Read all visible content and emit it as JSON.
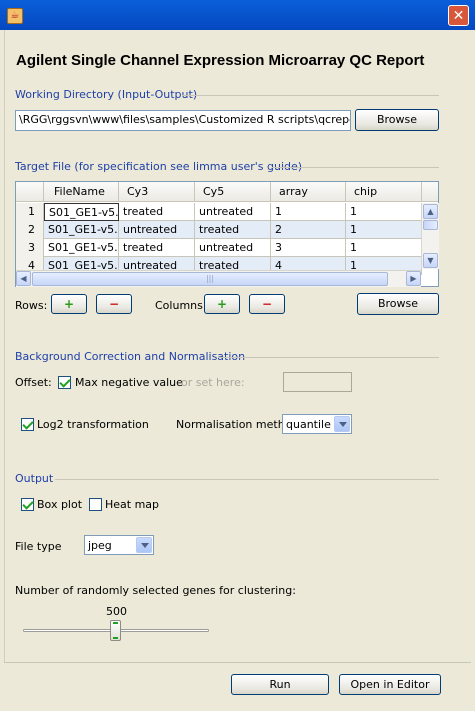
{
  "window": {
    "close_symbol": "✕",
    "icon": "java-cup-icon"
  },
  "report_title": "Agilent Single Channel Expression Microarray QC Report",
  "working_directory": {
    "label": "Working Directory (Input-Output)",
    "path": "\\RGG\\rggsvn\\www\\files\\samples\\Customized R scripts\\qcreport\\data",
    "browse_label": "Browse"
  },
  "target_file": {
    "label": "Target File   (for specification see limma user's guide)",
    "columns": [
      "",
      "FileName",
      "Cy3",
      "Cy5",
      "array",
      "chip"
    ],
    "rows": [
      [
        "1",
        "S01_GE1-v5...",
        "treated",
        "untreated",
        "1",
        "1"
      ],
      [
        "2",
        "S01_GE1-v5...",
        "untreated",
        "treated",
        "2",
        "1"
      ],
      [
        "3",
        "S01_GE1-v5...",
        "treated",
        "untreated",
        "3",
        "1"
      ],
      [
        "4",
        "S01_GE1-v5...",
        "untreated",
        "treated",
        "4",
        "1"
      ]
    ],
    "rows_label": "Rows:",
    "columns_label": "Columns:",
    "add_symbol": "+",
    "remove_symbol": "−",
    "browse_label": "Browse"
  },
  "background": {
    "label": "Background Correction and Normalisation",
    "offset_label": "Offset:",
    "max_negative_label": "Max negative value",
    "max_negative_checked": true,
    "or_set_label": "or set here:",
    "offset_value": "",
    "log2_label": "Log2 transformation",
    "log2_checked": true,
    "norm_method_label": "Normalisation method",
    "norm_method_value": "quantile"
  },
  "output": {
    "label": "Output",
    "box_plot_label": "Box plot",
    "box_plot_checked": true,
    "heat_map_label": "Heat map",
    "heat_map_checked": false,
    "file_type_label": "File type",
    "file_type_value": "jpeg",
    "genes_label": "Number of randomly selected genes for clustering:",
    "genes_value": "500",
    "genes_fraction": 0.5
  },
  "actions": {
    "run_label": "Run",
    "open_editor_label": "Open in Editor"
  }
}
